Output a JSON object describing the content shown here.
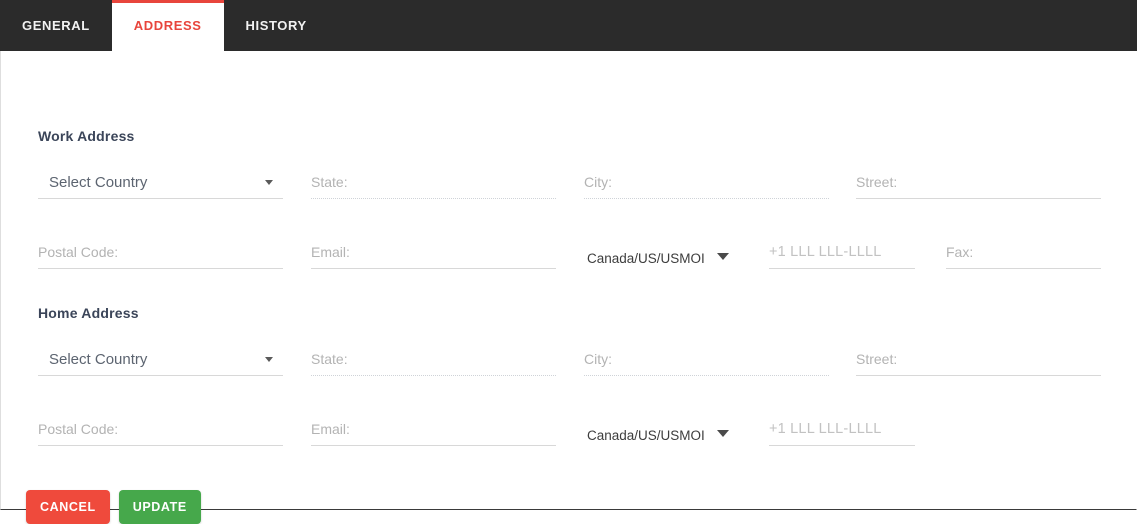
{
  "tabs": [
    {
      "label": "GENERAL",
      "active": false
    },
    {
      "label": "ADDRESS",
      "active": true
    },
    {
      "label": "HISTORY",
      "active": false
    }
  ],
  "work_address": {
    "title": "Work Address",
    "country": {
      "value": "Select Country"
    },
    "state": {
      "placeholder": "State:"
    },
    "city": {
      "placeholder": "City:"
    },
    "street": {
      "placeholder": "Street:"
    },
    "postal_code": {
      "placeholder": "Postal Code:"
    },
    "email": {
      "placeholder": "Email:"
    },
    "phone_country": {
      "value": "Canada/US/USMOI"
    },
    "phone": {
      "placeholder": "+1 LLL LLL-LLLL"
    },
    "fax": {
      "placeholder": "Fax:"
    }
  },
  "home_address": {
    "title": "Home Address",
    "country": {
      "value": "Select Country"
    },
    "state": {
      "placeholder": "State:"
    },
    "city": {
      "placeholder": "City:"
    },
    "street": {
      "placeholder": "Street:"
    },
    "postal_code": {
      "placeholder": "Postal Code:"
    },
    "email": {
      "placeholder": "Email:"
    },
    "phone_country": {
      "value": "Canada/US/USMOI"
    },
    "phone": {
      "placeholder": "+1 LLL LLL-LLLL"
    }
  },
  "actions": {
    "cancel_label": "CANCEL",
    "update_label": "UPDATE"
  },
  "colors": {
    "tabbar_bg": "#2b2b2b",
    "active_tab_text": "#e8453c",
    "active_tab_border": "#e8453c",
    "section_title": "#3b4559",
    "cancel_bg": "#ef4a3c",
    "update_bg": "#46a84b"
  }
}
